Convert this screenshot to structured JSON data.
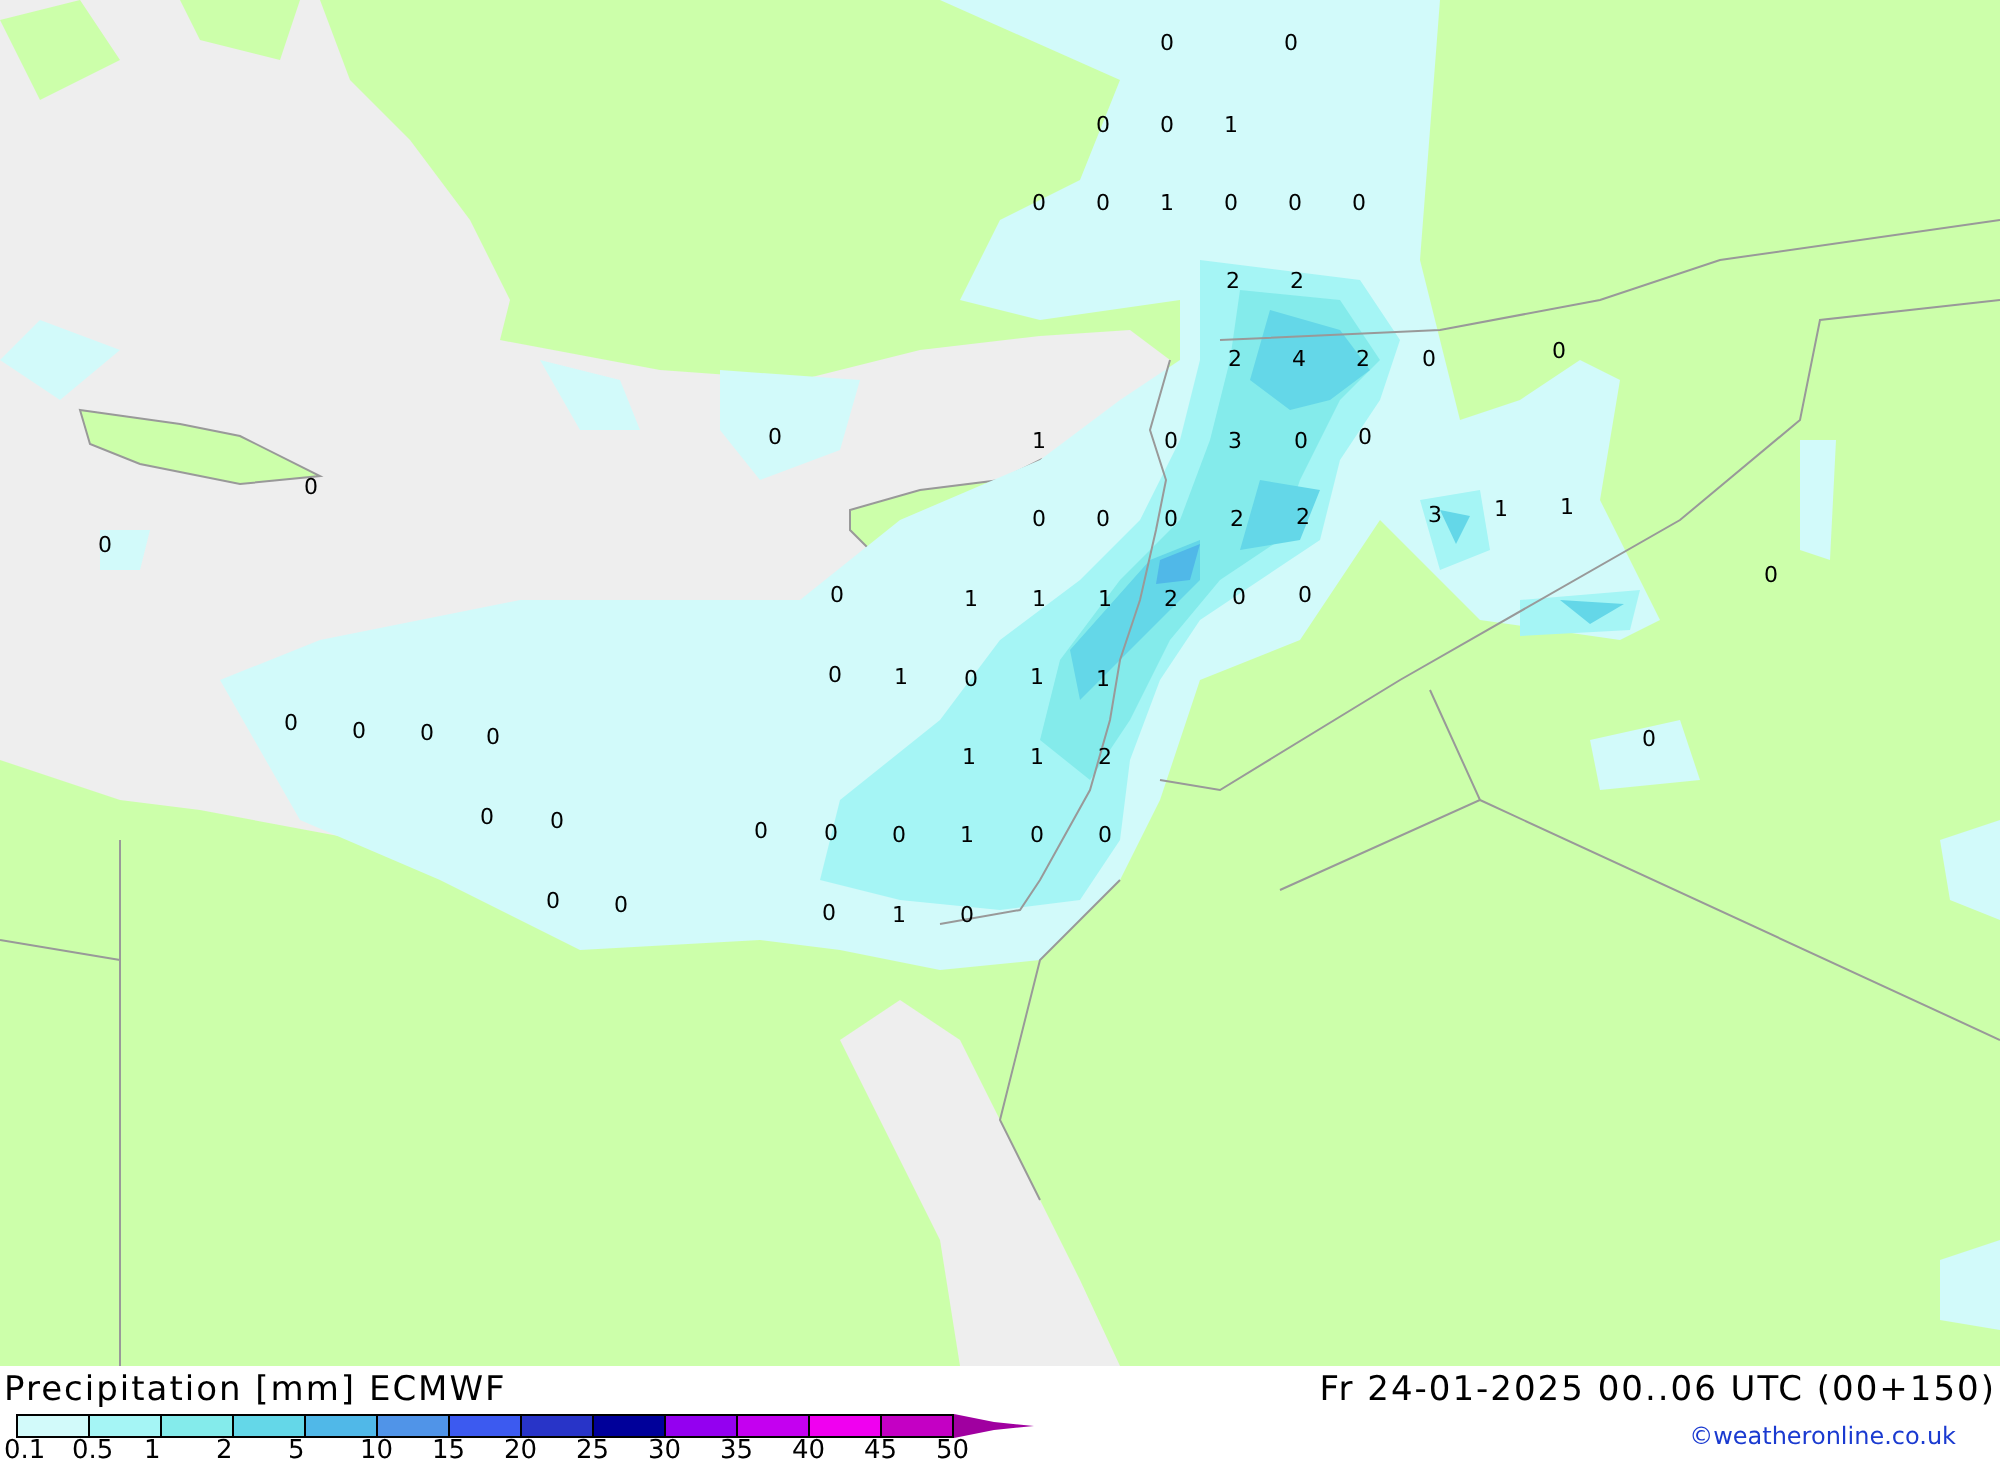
{
  "map": {
    "labels": [
      "0",
      "0",
      "0",
      "0",
      "1",
      "0",
      "0",
      "1",
      "0",
      "0",
      "0",
      "2",
      "2",
      "2",
      "4",
      "2",
      "0",
      "0",
      "0",
      "1",
      "0",
      "3",
      "0",
      "0",
      "0",
      "0",
      "0",
      "0",
      "2",
      "2",
      "3",
      "1",
      "1",
      "0",
      "0",
      "0",
      "1",
      "1",
      "1",
      "2",
      "0",
      "0",
      "0",
      "1",
      "0",
      "1",
      "1",
      "0",
      "0",
      "0",
      "0",
      "0",
      "1",
      "1",
      "2",
      "0",
      "0",
      "0",
      "0",
      "0",
      "1",
      "0",
      "0",
      "0",
      "0",
      "0",
      "1",
      "0"
    ]
  },
  "footer": {
    "title": "Precipitation [mm] ECMWF",
    "run": "Fr 24-01-2025 00..06 UTC (00+150)",
    "credit": "©weatheronline.co.uk",
    "legend": {
      "bins": [
        {
          "color": "#d2fafa"
        },
        {
          "color": "#a5f5f5"
        },
        {
          "color": "#84ebeb"
        },
        {
          "color": "#64d7e8"
        },
        {
          "color": "#50b8e8"
        },
        {
          "color": "#5094e8"
        },
        {
          "color": "#3c5af0"
        },
        {
          "color": "#2834c8"
        },
        {
          "color": "#00009a"
        },
        {
          "color": "#9400f0"
        },
        {
          "color": "#c400f0"
        },
        {
          "color": "#f000f0"
        },
        {
          "color": "#c400c4"
        },
        {
          "kind": "arrow",
          "color": "#a000a0"
        }
      ],
      "ticks": [
        "0.1",
        "0.5",
        "1",
        "2",
        "5",
        "10",
        "15",
        "20",
        "25",
        "30",
        "35",
        "40",
        "45",
        "50"
      ]
    }
  }
}
